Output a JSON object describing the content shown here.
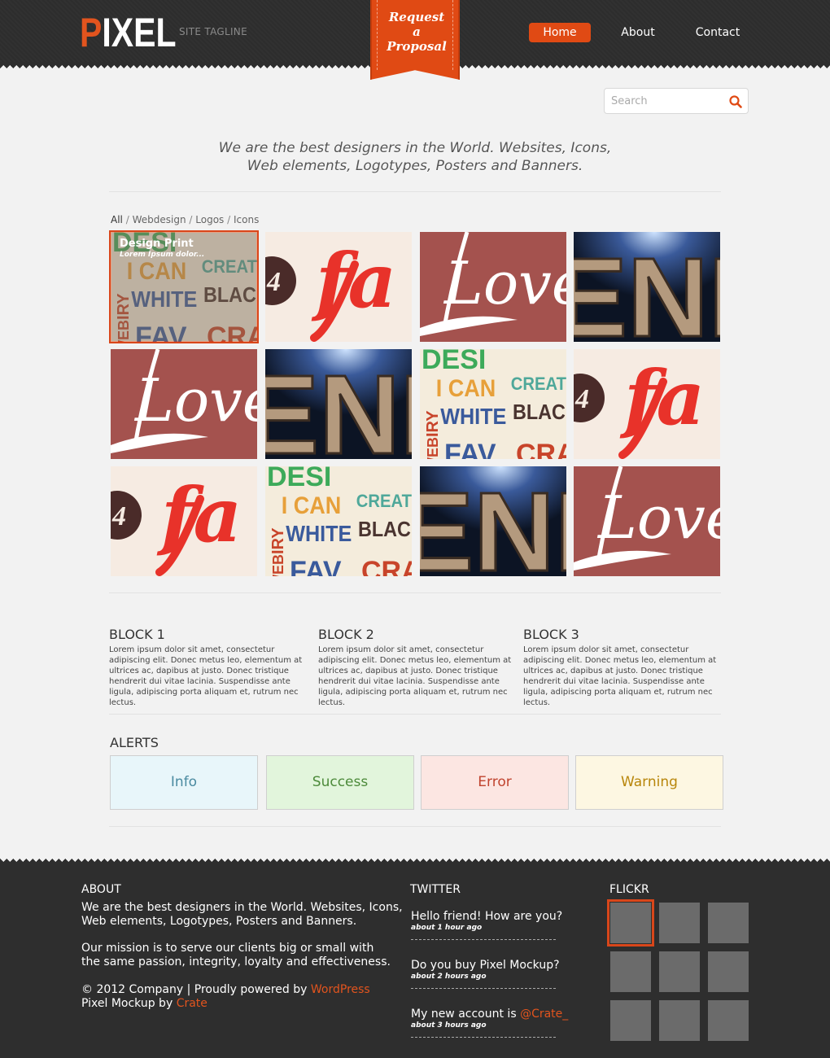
{
  "header": {
    "logo_first": "P",
    "logo_rest": "IXEL",
    "tagline": "SITE TAGLINE",
    "ribbon": "Request\na\nProposal",
    "nav": {
      "home": "Home",
      "about": "About",
      "contact": "Contact"
    }
  },
  "search": {
    "placeholder": "Search"
  },
  "hero": {
    "line1": "We are the best designers in the World. Websites, Icons,",
    "line2": "Web elements, Logotypes, Posters and Banners."
  },
  "filter": {
    "all": "All",
    "sep": "/",
    "webdesign": "Webdesign",
    "logos": "Logos",
    "icons": "Icons"
  },
  "portfolio": {
    "featured_title": "Design Print",
    "featured_sub": "Lorem Ipsum dolor...",
    "tile_words": {
      "four": "4",
      "fa": "fa",
      "love": "Love",
      "eni": "ENI",
      "desi": "DESI",
      "ican": "I CAN",
      "creat": "CREAT",
      "white": "WHITE",
      "blac": "BLAC",
      "iry": "IRY",
      "web": "WEB",
      "fav": "FAV",
      "cra": "CRA"
    }
  },
  "blocks": [
    {
      "title": "BLOCK 1",
      "text": "Lorem ipsum dolor sit amet, consectetur adipiscing elit. Donec metus leo, elementum at ultrices ac, dapibus at justo. Donec tristique hendrerit dui vitae lacinia. Suspendisse ante ligula, adipiscing porta aliquam et, rutrum nec lectus."
    },
    {
      "title": "BLOCK 2",
      "text": "Lorem ipsum dolor sit amet, consectetur adipiscing elit. Donec metus leo, elementum at ultrices ac, dapibus at justo. Donec tristique hendrerit dui vitae lacinia. Suspendisse ante ligula, adipiscing porta aliquam et, rutrum nec lectus."
    },
    {
      "title": "BLOCK 3",
      "text": "Lorem ipsum dolor sit amet, consectetur adipiscing elit. Donec metus leo, elementum at ultrices ac, dapibus at justo. Donec tristique hendrerit dui vitae lacinia. Suspendisse ante ligula, adipiscing porta aliquam et, rutrum nec lectus."
    }
  ],
  "alerts": {
    "title": "ALERTS",
    "info": "Info",
    "success": "Success",
    "error": "Error",
    "warning": "Warning"
  },
  "footer": {
    "about_head": "ABOUT",
    "about_p1": "We are the best designers in the World. Websites, Icons,\nWeb elements, Logotypes, Posters and Banners.",
    "about_p2": "Our mission is to serve our clients big or small with\nthe same passion, integrity, loyalty and effectiveness.",
    "copy_prefix": "© 2012 Company | Proudly powered by ",
    "copy_link": "WordPress",
    "credit_prefix": "Pixel Mockup by ",
    "credit_link": "Crate",
    "twitter_head": "TWITTER",
    "tweets": [
      {
        "text": "Hello friend! How are you?",
        "time": "about 1 hour ago"
      },
      {
        "text": "Do you buy Pixel Mockup?",
        "time": "about 2 hours ago"
      },
      {
        "text_prefix": "My new account is ",
        "handle": "@Crate_",
        "time": "about 3 hours ago"
      }
    ],
    "flickr_head": "FLICKR"
  },
  "colors": {
    "accent": "#e04a14",
    "dark": "#2e2e2e",
    "info_bg": "#e8f6fa",
    "info_text": "#4a8aa0",
    "success_bg": "#e2f5dc",
    "success_text": "#4c8a3a",
    "error_bg": "#fce6e2",
    "error_text": "#c0432e",
    "warning_bg": "#fdf7e2",
    "warning_text": "#b8860b"
  }
}
